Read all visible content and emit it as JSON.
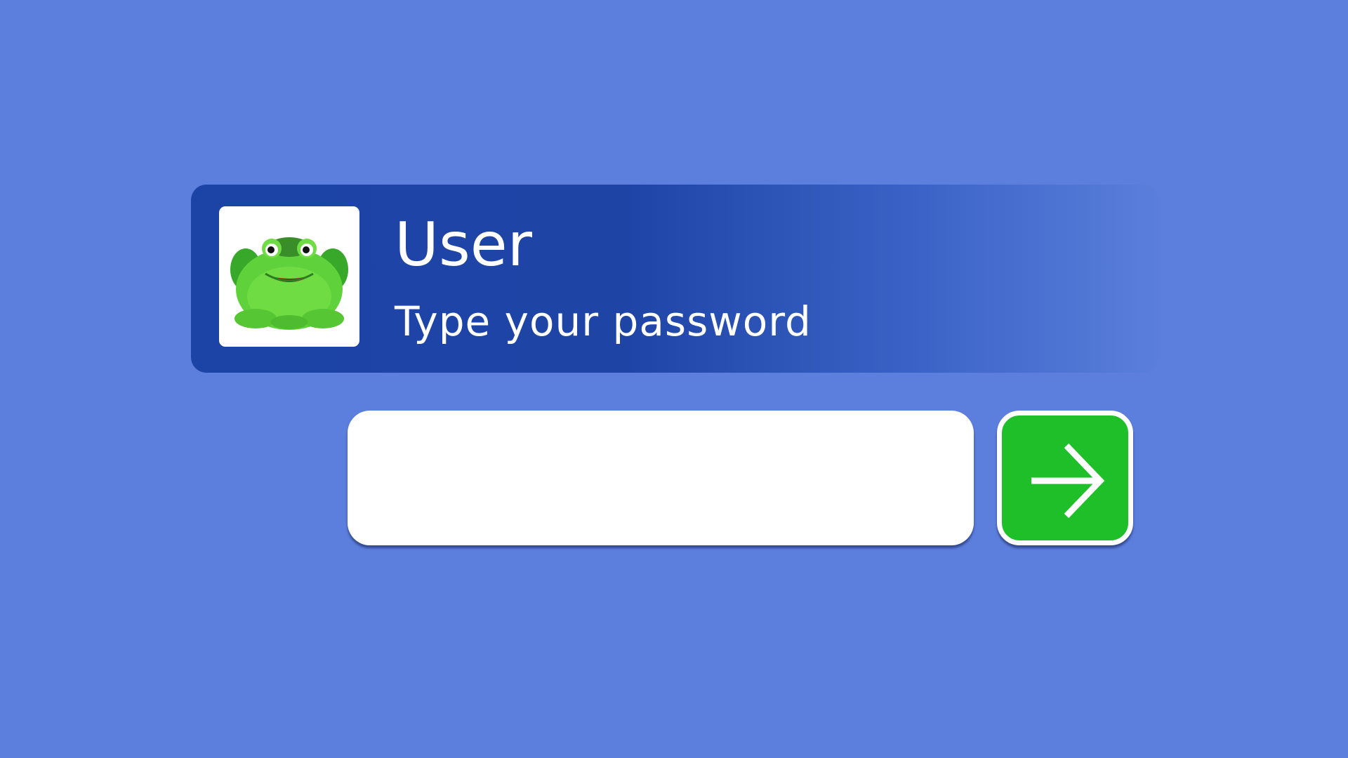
{
  "login": {
    "user_name": "User",
    "prompt": "Type your password",
    "password_value": "",
    "avatar_icon": "frog-avatar-icon",
    "submit_icon": "arrow-right-icon"
  },
  "colors": {
    "background": "#5c7fdd",
    "banner": "#1e44a6",
    "submit": "#1fbf2a",
    "field": "#ffffff"
  }
}
